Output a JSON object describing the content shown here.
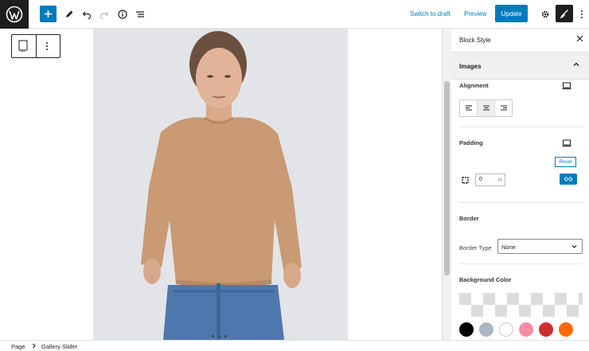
{
  "topbar": {
    "switch_draft": "Switch to draft",
    "preview": "Preview",
    "update": "Update",
    "icons": [
      "wordpress-logo-icon",
      "plus-icon",
      "pencil-icon",
      "undo-icon",
      "redo-icon",
      "info-icon",
      "list-view-icon",
      "gear-icon",
      "brush-icon",
      "kebab-icon"
    ]
  },
  "sidebar": {
    "title": "Block Style",
    "panel": "Images",
    "alignment_label": "Alignment",
    "padding_label": "Padding",
    "reset": "Reset",
    "padding_value": "0",
    "border_label": "Border",
    "border_type_label": "Border Type",
    "border_type_value": "None",
    "bg_color_label": "Background Color",
    "swatch_colors": [
      "#000000",
      "#abb8c3",
      "#ffffff",
      "#f78da7",
      "#cf2e2e",
      "#ff6900"
    ]
  },
  "footer": {
    "crumb1": "Page",
    "crumb2": "Gallery Slider"
  },
  "colors": {
    "accent": "#007cba",
    "dark": "#1e1e1e"
  }
}
